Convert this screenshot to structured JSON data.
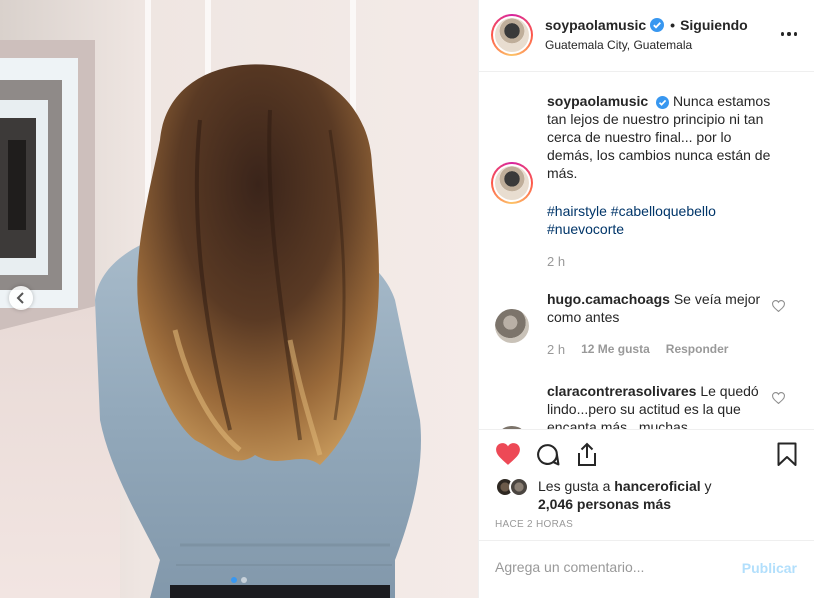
{
  "post": {
    "username": "soypaolamusic",
    "follow_status": "Siguiendo",
    "separator": "•",
    "location": "Guatemala City, Guatemala",
    "caption": "Nunca estamos tan lejos de nuestro principio ni tan cerca de nuestro final... por lo demás, los cambios nunca están de más.",
    "hashtags": "#hairstyle #cabelloquebello #nuevocorte",
    "caption_time": "2 h"
  },
  "comments": [
    {
      "username": "hugo.camachoags",
      "text": "Se veía mejor como antes",
      "time": "2 h",
      "likes": "12 Me gusta",
      "reply": "Responder"
    },
    {
      "username": "claracontrerasolivares",
      "text": "Le quedó lindo...pero su actitud es la que encanta más...muchas"
    }
  ],
  "likes": {
    "prefix": "Les gusta a",
    "user": "hanceroficial",
    "conj": "y",
    "others": "2,046 personas más"
  },
  "timestamp": "HACE 2 HORAS",
  "comment_box": {
    "placeholder": "Agrega un comentario...",
    "publish_label": "Publicar"
  },
  "carousel": {
    "total": 2,
    "active_index": 0
  },
  "colors": {
    "like_red": "#ed4956",
    "verified_blue": "#3897f0",
    "hashtag": "#003569",
    "muted": "#999999",
    "publish_disabled": "#b2dffc"
  },
  "icons": [
    "chevron-left-icon",
    "verified-badge-icon",
    "more-options-icon",
    "heart-icon",
    "comment-icon",
    "share-icon",
    "bookmark-icon"
  ]
}
